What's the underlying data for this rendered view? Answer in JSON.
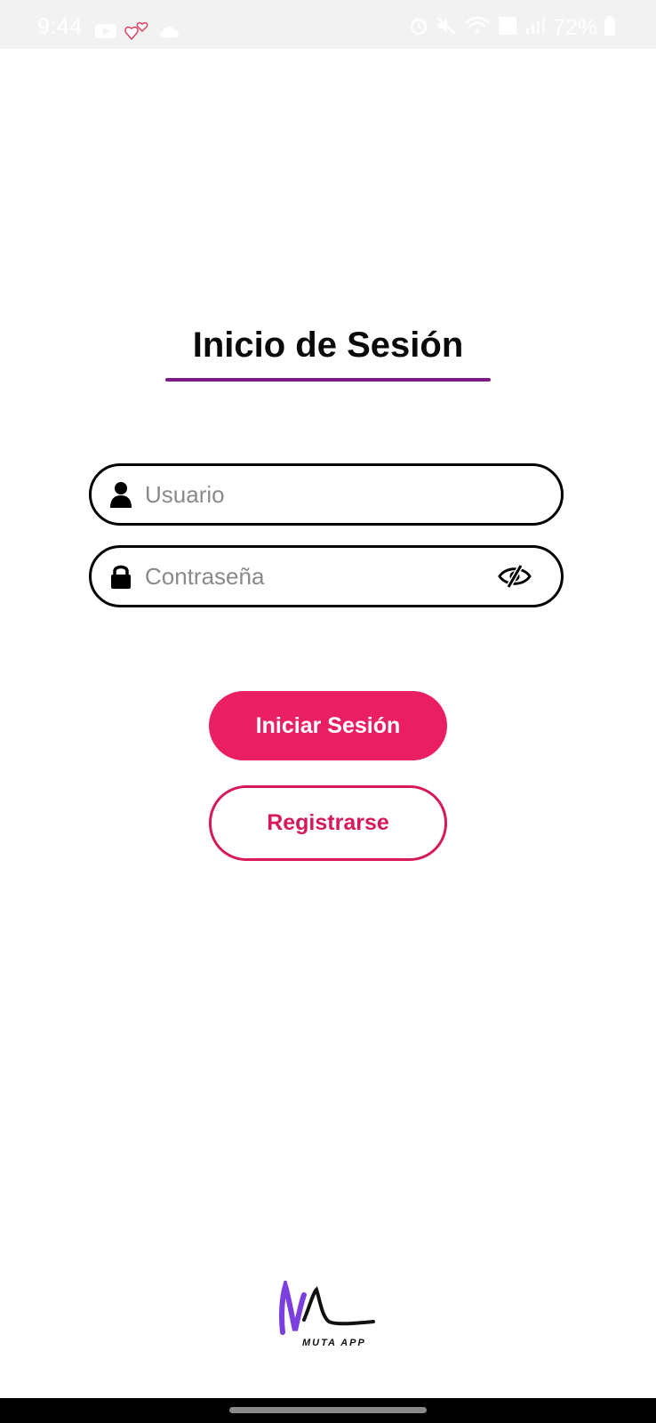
{
  "status_bar": {
    "time": "9:44",
    "battery": "72%",
    "left_icons": [
      "youtube-icon",
      "hearts-icon",
      "cloud-icon"
    ],
    "right_icons": [
      "alarm-icon",
      "mute-icon",
      "wifi-icon",
      "volte-icon",
      "signal-icon",
      "battery-icon"
    ]
  },
  "login": {
    "title": "Inicio de Sesión",
    "accent_color": "#7b1a88",
    "username": {
      "placeholder": "Usuario",
      "value": ""
    },
    "password": {
      "placeholder": "Contraseña",
      "value": ""
    },
    "login_button": "Iniciar Sesión",
    "register_button": "Registrarse",
    "primary_color": "#e91e63"
  },
  "footer": {
    "logo_text": "MUTA APP"
  }
}
